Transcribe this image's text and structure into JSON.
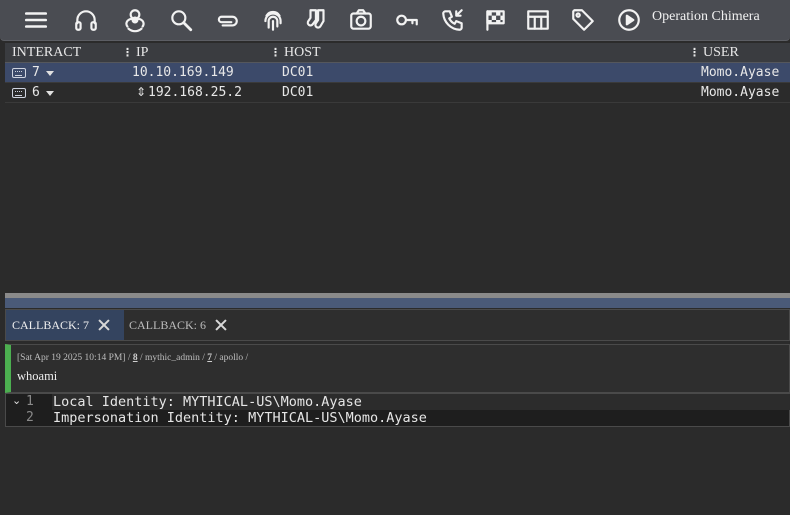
{
  "toolbar": {
    "icons": [
      "menu-icon",
      "headphones-icon",
      "biohazard-icon",
      "search-icon",
      "paperclip-icon",
      "fingerprint-icon",
      "socks-icon",
      "camera-icon",
      "key-icon",
      "phone-callback-icon",
      "checkered-flag-icon",
      "table-icon",
      "tag-icon",
      "play-circle-icon"
    ],
    "operation": "Operation Chimera"
  },
  "table": {
    "headers": {
      "interact": "INTERACT",
      "ip": "IP",
      "host": "HOST",
      "user": "USER"
    },
    "rows": [
      {
        "id": "7",
        "ip": "10.10.169.149",
        "host": "DC01",
        "user": "Momo.Ayase",
        "selected": true
      },
      {
        "id": "6",
        "ip": "192.168.25.2",
        "host": "DC01",
        "user": "Momo.Ayase",
        "selected": false
      }
    ]
  },
  "tabs": [
    {
      "label": "CALLBACK: 7",
      "active": true
    },
    {
      "label": "CALLBACK: 6",
      "active": false
    }
  ],
  "task": {
    "timestamp": "[Sat Apr 19 2025 10:14 PM]",
    "sep1": " / ",
    "task_num": "8",
    "sep2": " / mythic_admin / ",
    "callback_num": "7",
    "sep3": " / apollo / ",
    "command": "whoami"
  },
  "output": {
    "lines": [
      {
        "num": "1",
        "text": "Local Identity: MYTHICAL-US\\Momo.Ayase"
      },
      {
        "num": "2",
        "text": "Impersonation Identity: MYTHICAL-US\\Momo.Ayase"
      }
    ]
  },
  "colors": {
    "selected_row": "#3c4a6a",
    "active_tab": "#34445f",
    "task_status": "#4caf50"
  }
}
